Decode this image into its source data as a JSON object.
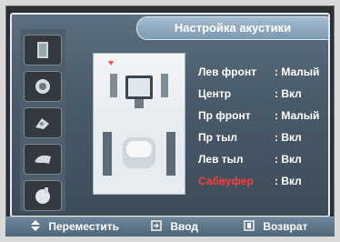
{
  "menu": {
    "title": "Настройка акустики"
  },
  "side_icons": [
    {
      "icon": "speaker-panel-icon"
    },
    {
      "icon": "speaker-round-icon"
    },
    {
      "icon": "hand-sound-icon"
    },
    {
      "icon": "horn-icon"
    },
    {
      "icon": "subwoofer-ball-icon"
    }
  ],
  "settings": [
    {
      "label": "Лев фронт",
      "value": ": Малый",
      "active": false
    },
    {
      "label": "Центр",
      "value": ": Вкл",
      "active": false
    },
    {
      "label": "Пр фронт",
      "value": ": Малый",
      "active": false
    },
    {
      "label": "Пр тыл",
      "value": ": Вкл",
      "active": false
    },
    {
      "label": "Лев тыл",
      "value": ": Вкл",
      "active": false
    },
    {
      "label": "Сабвуфер",
      "value": ": Вкл",
      "active": true
    }
  ],
  "footer": {
    "move": "Переместить",
    "enter": "Ввод",
    "return": "Возврат"
  },
  "colors": {
    "active_label": "#ff3b3b",
    "panel": "#4a5b6a"
  }
}
